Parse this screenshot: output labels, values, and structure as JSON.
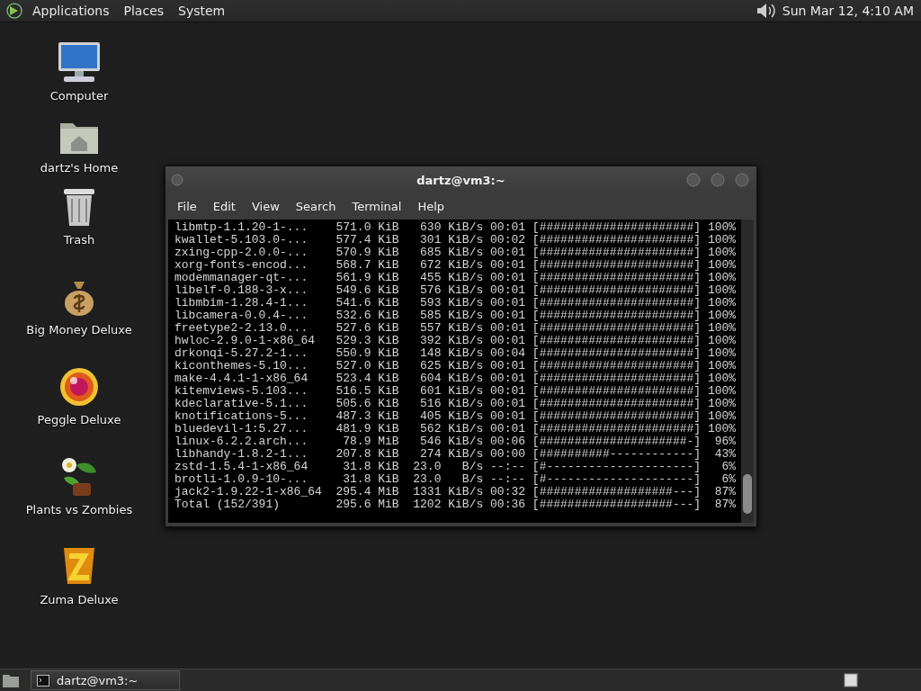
{
  "top_panel": {
    "menus": [
      "Applications",
      "Places",
      "System"
    ],
    "clock": "Sun Mar 12, 4:10 AM"
  },
  "desktop_icons": [
    {
      "label": "Computer",
      "kind": "computer"
    },
    {
      "label": "dartz's Home",
      "kind": "home"
    },
    {
      "label": "Trash",
      "kind": "trash"
    },
    {
      "label": "Big Money Deluxe",
      "kind": "moneybag"
    },
    {
      "label": "Peggle Deluxe",
      "kind": "ball"
    },
    {
      "label": "Plants vs Zombies",
      "kind": "plant"
    },
    {
      "label": "Zuma Deluxe",
      "kind": "block"
    }
  ],
  "terminal": {
    "title": "dartz@vm3:~",
    "menu": [
      "File",
      "Edit",
      "View",
      "Search",
      "Terminal",
      "Help"
    ],
    "lines": [
      "libmtp-1.1.20-1-...    571.0 KiB   630 KiB/s 00:01 [######################] 100%",
      "kwallet-5.103.0-...    577.4 KiB   301 KiB/s 00:02 [######################] 100%",
      "zxing-cpp-2.0.0-...    570.9 KiB   685 KiB/s 00:01 [######################] 100%",
      "xorg-fonts-encod...    568.7 KiB   672 KiB/s 00:01 [######################] 100%",
      "modemmanager-qt-...    561.9 KiB   455 KiB/s 00:01 [######################] 100%",
      "libelf-0.188-3-x...    549.6 KiB   576 KiB/s 00:01 [######################] 100%",
      "libmbim-1.28.4-1...    541.6 KiB   593 KiB/s 00:01 [######################] 100%",
      "libcamera-0.0.4-...    532.6 KiB   585 KiB/s 00:01 [######################] 100%",
      "freetype2-2.13.0...    527.6 KiB   557 KiB/s 00:01 [######################] 100%",
      "hwloc-2.9.0-1-x86_64   529.3 KiB   392 KiB/s 00:01 [######################] 100%",
      "drkonqi-5.27.2-1...    550.9 KiB   148 KiB/s 00:04 [######################] 100%",
      "kiconthemes-5.10...    527.0 KiB   625 KiB/s 00:01 [######################] 100%",
      "make-4.4.1-1-x86_64    523.4 KiB   604 KiB/s 00:01 [######################] 100%",
      "kitemviews-5.103...    516.5 KiB   601 KiB/s 00:01 [######################] 100%",
      "kdeclarative-5.1...    505.6 KiB   516 KiB/s 00:01 [######################] 100%",
      "knotifications-5...    487.3 KiB   405 KiB/s 00:01 [######################] 100%",
      "bluedevil-1:5.27...    481.9 KiB   562 KiB/s 00:01 [######################] 100%",
      "linux-6.2.2.arch...     78.9 MiB   546 KiB/s 00:06 [#####################-]  96%",
      "libhandy-1.8.2-1...    207.8 KiB   274 KiB/s 00:00 [##########------------]  43%",
      "zstd-1.5.4-1-x86_64     31.8 KiB  23.0   B/s --:-- [#---------------------]   6%",
      "brotli-1.0.9-10-...     31.8 KiB  23.0   B/s --:-- [#---------------------]   6%",
      "jack2-1.9.22-1-x86_64  295.4 MiB  1331 KiB/s 00:32 [###################---]  87%",
      "Total (152/391)        295.6 MiB  1202 KiB/s 00:36 [###################---]  87%"
    ]
  },
  "taskbar": {
    "tasks": [
      {
        "label": "dartz@vm3:~",
        "selected": true
      }
    ]
  }
}
